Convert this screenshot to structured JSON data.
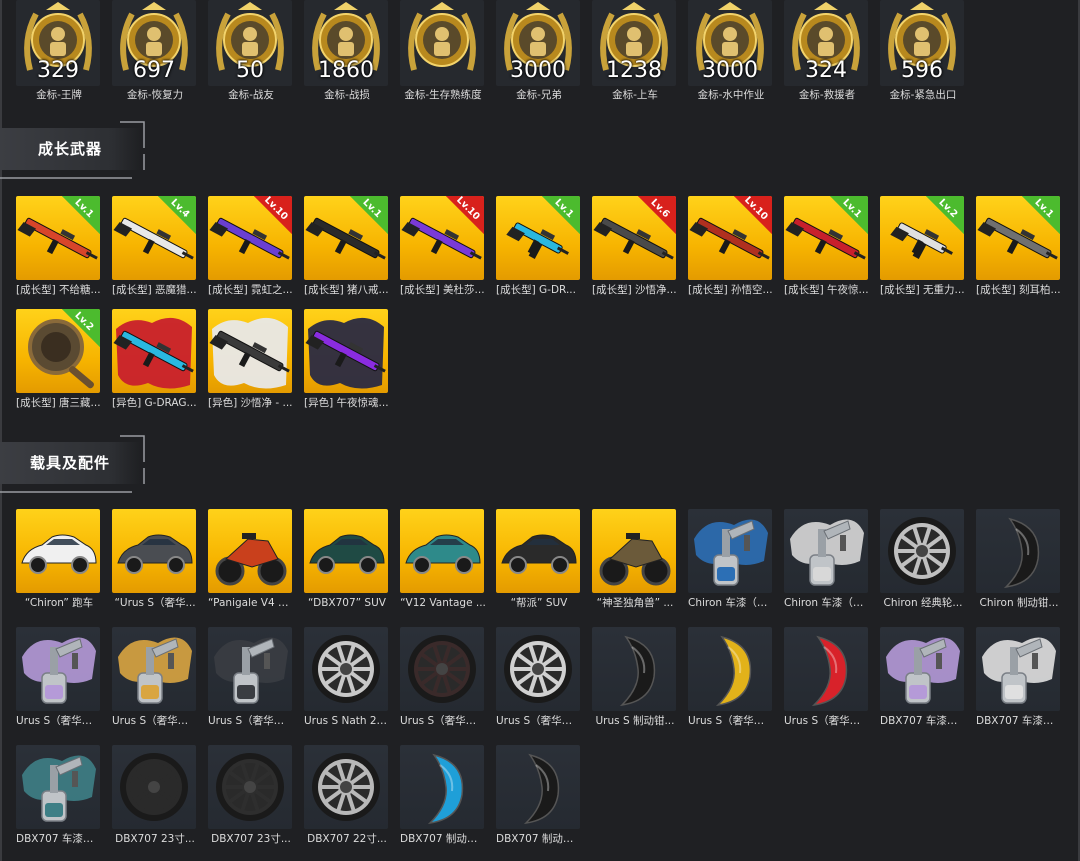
{
  "medals": [
    {
      "count": "329",
      "label": "金标-王牌",
      "icon": "ace-medal-icon"
    },
    {
      "count": "697",
      "label": "金标-恢复力",
      "icon": "recovery-medal-icon"
    },
    {
      "count": "50",
      "label": "金标-战友",
      "icon": "comrade-medal-icon"
    },
    {
      "count": "1860",
      "label": "金标-战损",
      "icon": "battle-damage-medal-icon"
    },
    {
      "count": "",
      "label": "金标-生存熟练度",
      "icon": "survival-medal-icon"
    },
    {
      "count": "3000",
      "label": "金标-兄弟",
      "icon": "brothers-medal-icon"
    },
    {
      "count": "1238",
      "label": "金标-上车",
      "icon": "vehicle-medal-icon"
    },
    {
      "count": "3000",
      "label": "金标-水中作业",
      "icon": "underwater-medal-icon"
    },
    {
      "count": "324",
      "label": "金标-救援者",
      "icon": "rescuer-medal-icon"
    },
    {
      "count": "596",
      "label": "金标-紧急出口",
      "icon": "emergency-exit-medal-icon"
    }
  ],
  "sections": {
    "weapons_title": "成长武器",
    "vehicles_title": "载具及配件"
  },
  "weapons": [
    {
      "label": "[成长型] 不给糖...",
      "badge": "Lv.1",
      "badge_color": "green",
      "icon": "rifle-icon",
      "accent": "#d8452a"
    },
    {
      "label": "[成长型] 恶魔猎...",
      "badge": "Lv.4",
      "badge_color": "green",
      "icon": "rifle-icon",
      "accent": "#e8e8e8"
    },
    {
      "label": "[成长型] 霓虹之...",
      "badge": "Lv.10",
      "badge_color": "red",
      "icon": "rifle-icon",
      "accent": "#6a3fd1"
    },
    {
      "label": "[成长型] 猪八戒...",
      "badge": "Lv.1",
      "badge_color": "green",
      "icon": "rifle-icon",
      "accent": "#2a2a2a"
    },
    {
      "label": "[成长型] 美杜莎...",
      "badge": "Lv.10",
      "badge_color": "red",
      "icon": "rifle-icon",
      "accent": "#7a3ad8"
    },
    {
      "label": "[成长型] G-DR...",
      "badge": "Lv.1",
      "badge_color": "green",
      "icon": "smg-icon",
      "accent": "#2ab8e0"
    },
    {
      "label": "[成长型] 沙悟净...",
      "badge": "Lv.6",
      "badge_color": "red",
      "icon": "rifle-icon",
      "accent": "#4a4a4a"
    },
    {
      "label": "[成长型] 孙悟空...",
      "badge": "Lv.10",
      "badge_color": "red",
      "icon": "rifle-icon",
      "accent": "#b0301f"
    },
    {
      "label": "[成长型] 午夜惊...",
      "badge": "Lv.1",
      "badge_color": "green",
      "icon": "shotgun-icon",
      "accent": "#c8202c"
    },
    {
      "label": "[成长型] 无重力...",
      "badge": "Lv.2",
      "badge_color": "green",
      "icon": "smg-icon",
      "accent": "#e0e0e0"
    },
    {
      "label": "[成长型] 刻耳柏...",
      "badge": "Lv.1",
      "badge_color": "green",
      "icon": "rifle-icon",
      "accent": "#707070"
    },
    {
      "label": "[成长型] 唐三藏...",
      "badge": "Lv.2",
      "badge_color": "green",
      "icon": "pan-icon",
      "accent": "#5a4a32"
    },
    {
      "label": "[异色] G-DRAG...",
      "badge": "",
      "badge_color": "",
      "icon": "rifle-icon",
      "accent": "#2ab8e0",
      "splash": "#c8202c"
    },
    {
      "label": "[异色] 沙悟净 - ...",
      "badge": "",
      "badge_color": "",
      "icon": "rifle-icon",
      "accent": "#3a3a3a",
      "splash": "#e8e8e8"
    },
    {
      "label": "[异色] 午夜惊魂...",
      "badge": "",
      "badge_color": "",
      "icon": "shotgun-icon",
      "accent": "#8a2ce0",
      "splash": "#2a2a42"
    }
  ],
  "vehicles": [
    {
      "label": "“Chiron” 跑车",
      "kind": "car",
      "bg": "gold",
      "color": "#f0f0f0",
      "icon": "sports-car-icon"
    },
    {
      "label": "“Urus S（奢华...",
      "kind": "car",
      "bg": "gold",
      "color": "#4a4d52",
      "icon": "suv-icon"
    },
    {
      "label": "“Panigale V4 S...",
      "kind": "bike",
      "bg": "gold",
      "color": "#c9401c",
      "icon": "motorcycle-icon"
    },
    {
      "label": "“DBX707” SUV",
      "kind": "car",
      "bg": "gold",
      "color": "#1f4a44",
      "icon": "suv-icon"
    },
    {
      "label": "“V12 Vantage ...",
      "kind": "car",
      "bg": "gold",
      "color": "#2e8a8a",
      "icon": "sports-car-icon"
    },
    {
      "label": "“帮派” SUV",
      "kind": "car",
      "bg": "gold",
      "color": "#2a2a2a",
      "icon": "classic-car-icon"
    },
    {
      "label": "“神圣独角兽” ...",
      "kind": "bike",
      "bg": "gold",
      "color": "#6b5a3a",
      "icon": "motorcycle-icon"
    },
    {
      "label": "Chiron 车漆（M...",
      "kind": "paint",
      "bg": "dark",
      "color": "#2c6fb5",
      "icon": "spray-gun-icon"
    },
    {
      "label": "Chiron 车漆（B...",
      "kind": "paint",
      "bg": "dark",
      "color": "#d8d8d8",
      "icon": "spray-gun-icon"
    },
    {
      "label": "Chiron 经典轮...",
      "kind": "wheel",
      "bg": "dark",
      "color": "#c0c0c0",
      "icon": "wheel-icon"
    },
    {
      "label": "Chiron 制动钳...",
      "kind": "caliper",
      "bg": "dark",
      "color": "#1a1a1a",
      "icon": "brake-caliper-icon"
    },
    {
      "label": "Urus S（奢华版...",
      "kind": "paint",
      "bg": "dark",
      "color": "#b59ad8",
      "icon": "spray-gun-icon"
    },
    {
      "label": "Urus S（奢华版...",
      "kind": "paint",
      "bg": "dark",
      "color": "#d9a541",
      "icon": "spray-gun-icon"
    },
    {
      "label": "Urus S（奢华版...",
      "kind": "paint",
      "bg": "dark",
      "color": "#3a3d42",
      "icon": "spray-gun-icon"
    },
    {
      "label": "Urus S Nath 22...",
      "kind": "wheel",
      "bg": "dark",
      "color": "#c8c8c8",
      "icon": "wheel-icon"
    },
    {
      "label": "Urus S（奢华版...",
      "kind": "wheel",
      "bg": "dark",
      "color": "#3a2a2a",
      "icon": "wheel-icon"
    },
    {
      "label": "Urus S（奢华版...",
      "kind": "wheel",
      "bg": "dark",
      "color": "#d0d0d0",
      "icon": "wheel-icon"
    },
    {
      "label": "Urus S 制动钳...",
      "kind": "caliper",
      "bg": "dark",
      "color": "#1a1a1a",
      "icon": "brake-caliper-icon"
    },
    {
      "label": "Urus S（奢华版...",
      "kind": "caliper",
      "bg": "dark",
      "color": "#e2b21a",
      "icon": "brake-caliper-icon"
    },
    {
      "label": "Urus S（奢华版...",
      "kind": "caliper",
      "bg": "dark",
      "color": "#d8222a",
      "icon": "brake-caliper-icon"
    },
    {
      "label": "DBX707 车漆（...",
      "kind": "paint",
      "bg": "dark",
      "color": "#b59ad8",
      "icon": "spray-gun-icon"
    },
    {
      "label": "DBX707 车漆（...",
      "kind": "paint",
      "bg": "dark",
      "color": "#e0e0e0",
      "icon": "spray-gun-icon"
    },
    {
      "label": "DBX707 车漆（...",
      "kind": "paint",
      "bg": "dark",
      "color": "#3e7f86",
      "icon": "spray-gun-icon"
    },
    {
      "label": "DBX707 23寸...",
      "kind": "wheel",
      "bg": "dark",
      "color": "#2a2a2a",
      "icon": "wheel-icon"
    },
    {
      "label": "DBX707 23寸...",
      "kind": "wheel",
      "bg": "dark",
      "color": "#2e2e2e",
      "icon": "wheel-icon"
    },
    {
      "label": "DBX707 22寸...",
      "kind": "wheel",
      "bg": "dark",
      "color": "#b8b8b8",
      "icon": "wheel-icon"
    },
    {
      "label": "DBX707 制动钳...",
      "kind": "caliper",
      "bg": "dark",
      "color": "#1f9fd8",
      "icon": "brake-caliper-icon"
    },
    {
      "label": "DBX707 制动钳...",
      "kind": "caliper",
      "bg": "dark",
      "color": "#1a1a1a",
      "icon": "brake-caliper-icon"
    }
  ]
}
